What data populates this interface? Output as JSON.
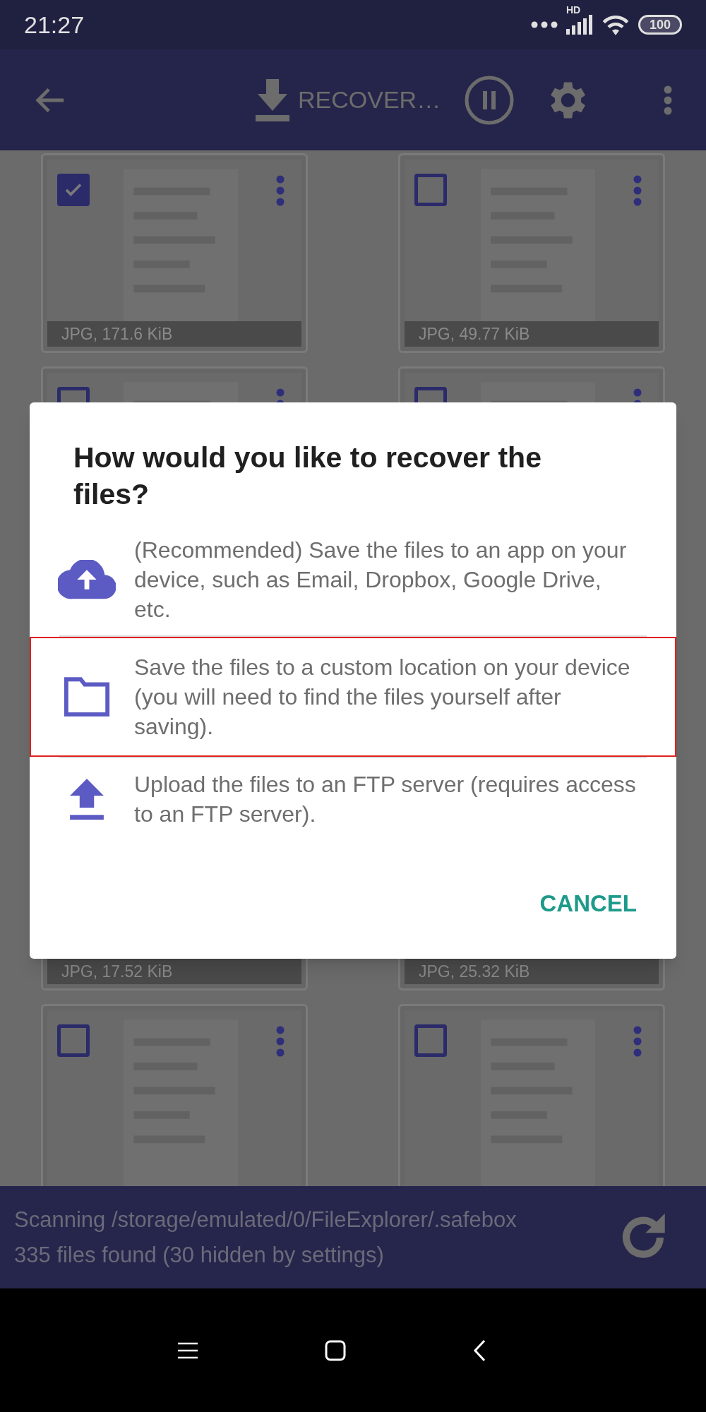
{
  "status_bar": {
    "time": "21:27",
    "network": "HD",
    "battery": "100"
  },
  "app_bar": {
    "action": "RECOVER…"
  },
  "cards_top": [
    {
      "checked": true,
      "label": "JPG, 171.6 KiB"
    },
    {
      "checked": false,
      "label": "JPG, 49.77 KiB"
    },
    {
      "checked": false
    },
    {
      "checked": false
    }
  ],
  "cards_bottom": [
    {
      "label": "JPG, 17.52 KiB"
    },
    {
      "label": "JPG, 25.32 KiB"
    },
    {
      "checked": false
    },
    {
      "checked": false
    }
  ],
  "dialog": {
    "title": "How would you like to recover the files?",
    "options": [
      {
        "kind": "cloud",
        "text": "(Recommended) Save the files to an app on your device, such as Email, Dropbox, Google Drive, etc.",
        "highlighted": false
      },
      {
        "kind": "folder",
        "text": "Save the files to a custom location on your device (you will need to find the files yourself after saving).",
        "highlighted": true
      },
      {
        "kind": "upload",
        "text": "Upload the files to an FTP server (requires access to an FTP server).",
        "highlighted": false
      }
    ],
    "cancel": "CANCEL"
  },
  "scan_bar": {
    "path": "Scanning /storage/emulated/0/FileExplorer/.safebox",
    "count": "335 files found (30 hidden by settings)"
  }
}
